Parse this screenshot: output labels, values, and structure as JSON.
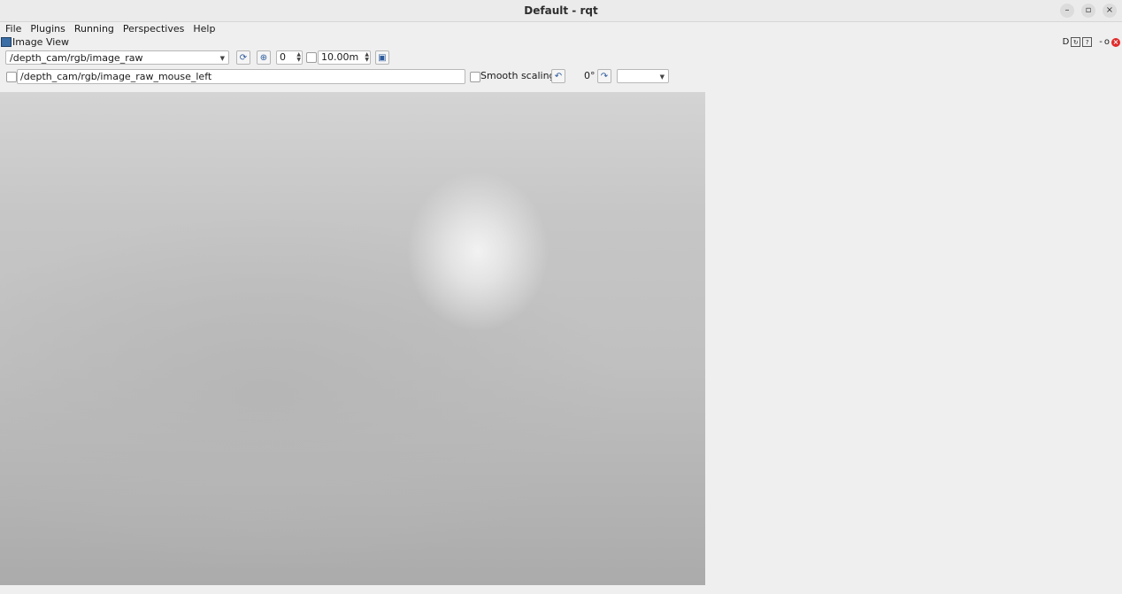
{
  "window": {
    "title": "Default - rqt"
  },
  "menu": [
    "File",
    "Plugins",
    "Running",
    "Perspectives",
    "Help"
  ],
  "plugin": {
    "title": "Image View",
    "dock_right_label": "D"
  },
  "toolbar": {
    "topic": "/depth_cam/rgb/image_raw",
    "zoom_value": "0",
    "max_depth": "10.00m",
    "mouse_topic": "/depth_cam/rgb/image_raw_mouse_left",
    "smooth_scaling_label": "Smooth scaling",
    "rotation": "0°"
  }
}
